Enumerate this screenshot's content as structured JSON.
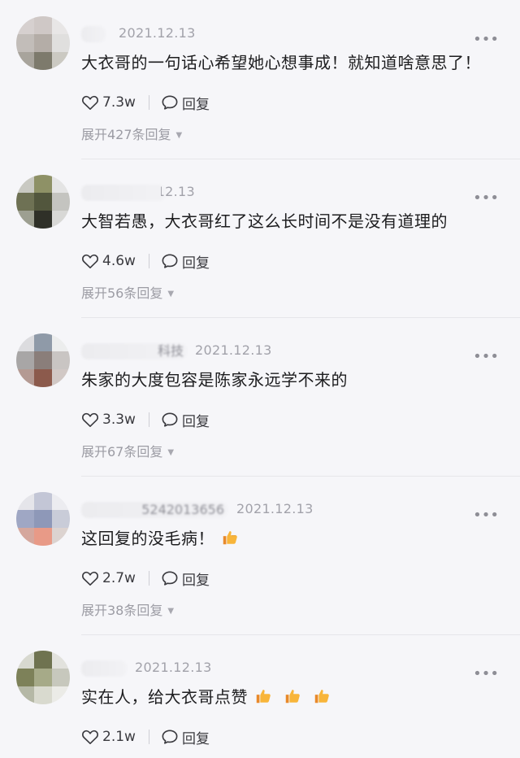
{
  "comments": [
    {
      "username_tail": "",
      "date": "2021.12.13",
      "text": "大衣哥的一句话心希望她心想事成！就知道啥意思了！",
      "likes": "7.3w",
      "reply_label": "回复",
      "expand": "展开427条回复",
      "thumbs": 0
    },
    {
      "username_tail": "",
      "date": "2021.12.13",
      "text": "大智若愚，大衣哥红了这么长时间不是没有道理的",
      "likes": "4.6w",
      "reply_label": "回复",
      "expand": "展开56条回复",
      "thumbs": 0
    },
    {
      "username_tail": "科技",
      "date": "2021.12.13",
      "text": "朱家的大度包容是陈家永远学不来的",
      "likes": "3.3w",
      "reply_label": "回复",
      "expand": "展开67条回复",
      "thumbs": 0
    },
    {
      "username_tail": "5242013656",
      "date": "2021.12.13",
      "text": "这回复的没毛病！",
      "likes": "2.7w",
      "reply_label": "回复",
      "expand": "展开38条回复",
      "thumbs": 1
    },
    {
      "username_tail": "",
      "date": "2021.12.13",
      "text": "实在人，给大衣哥点赞",
      "likes": "2.1w",
      "reply_label": "回复",
      "expand": "",
      "thumbs": 3
    }
  ],
  "icons": {
    "like": "heart-outline-icon",
    "reply": "speech-bubble-icon",
    "more": "ellipsis-icon",
    "thumb": "thumbs-up-emoji-icon",
    "expand_caret": "caret-down-icon"
  },
  "colors": {
    "background": "#f6f6f9",
    "text": "#1d1d1f",
    "meta": "#a2a2aa",
    "thumb_emoji": "#f5a623"
  }
}
